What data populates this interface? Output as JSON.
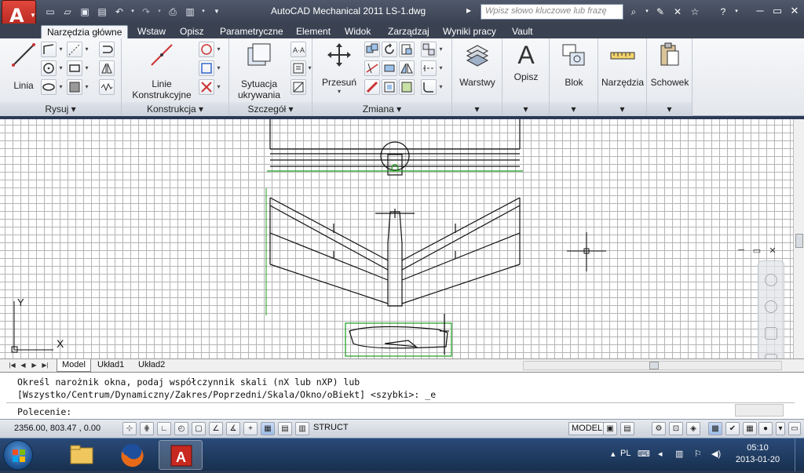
{
  "window": {
    "title": "AutoCAD Mechanical 2011    LS-1.dwg",
    "search_placeholder": "Wpisz słowo kluczowe lub frazę",
    "app_letter": "A",
    "app_sub": "M"
  },
  "tabs": [
    "Narzędzia główne",
    "Wstaw",
    "Opisz",
    "Parametryczne",
    "Element",
    "Widok",
    "Zarządzaj",
    "Wyniki pracy",
    "Vault"
  ],
  "panels": {
    "rysuj": {
      "title": "Rysuj",
      "big_label": "Linia"
    },
    "konstrukcja": {
      "title": "Konstrukcja",
      "big_label": "Linie Konstrukcyjne"
    },
    "szczegol": {
      "title": "Szczegół",
      "big_label": "Sytuacja ukrywania"
    },
    "zmiana": {
      "title": "Zmiana",
      "big_label": "Przesuń"
    },
    "warstwy": {
      "label": "Warstwy"
    },
    "opisz": {
      "label": "Opisz"
    },
    "blok": {
      "label": "Blok"
    },
    "narzedzia": {
      "label": "Narzędzia"
    },
    "schowek": {
      "label": "Schowek"
    }
  },
  "layout_tabs": [
    "Model",
    "Układ1",
    "Układ2"
  ],
  "command": {
    "line1": "Określ narożnik okna, podaj współczynnik skali (nX lub nXP) lub",
    "line2": "[Wszystko/Centrum/Dynamiczny/Zakres/Poprzedni/Skala/Okno/oBiekt] <szybki>: _e",
    "line3": "Polecenie:"
  },
  "status": {
    "coords": "2356.00, 803.47 , 0.00",
    "struct_label": "STRUCT",
    "model_label": "MODEL"
  },
  "taskbar": {
    "lang": "PL",
    "time": "05:10",
    "date": "2013-01-20"
  }
}
